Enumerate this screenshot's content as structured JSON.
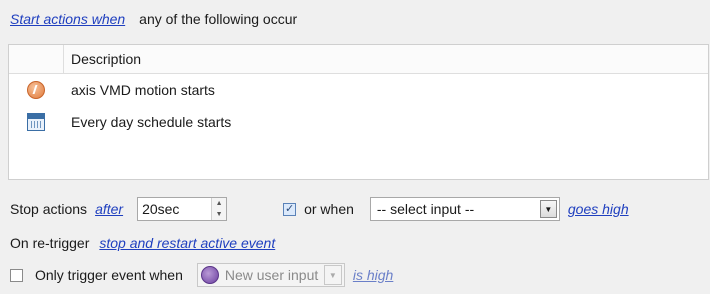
{
  "start": {
    "link": "Start actions when",
    "condition": "any of the following occur"
  },
  "table": {
    "header": "Description",
    "rows": [
      {
        "icon": "motion-icon",
        "label": "axis VMD motion starts"
      },
      {
        "icon": "calendar-icon",
        "label": "Every day schedule starts"
      }
    ]
  },
  "stop": {
    "label": "Stop actions",
    "after_link": "after",
    "duration": "20sec",
    "or_when_checked": true,
    "or_when_label": "or when",
    "input_select": "-- select input --",
    "goes_high_link": "goes high"
  },
  "retrigger": {
    "label": "On re-trigger",
    "action_link": "stop and restart active event"
  },
  "only_trigger": {
    "checked": false,
    "label": "Only trigger event when",
    "input": "New user input",
    "state_link": "is high"
  }
}
